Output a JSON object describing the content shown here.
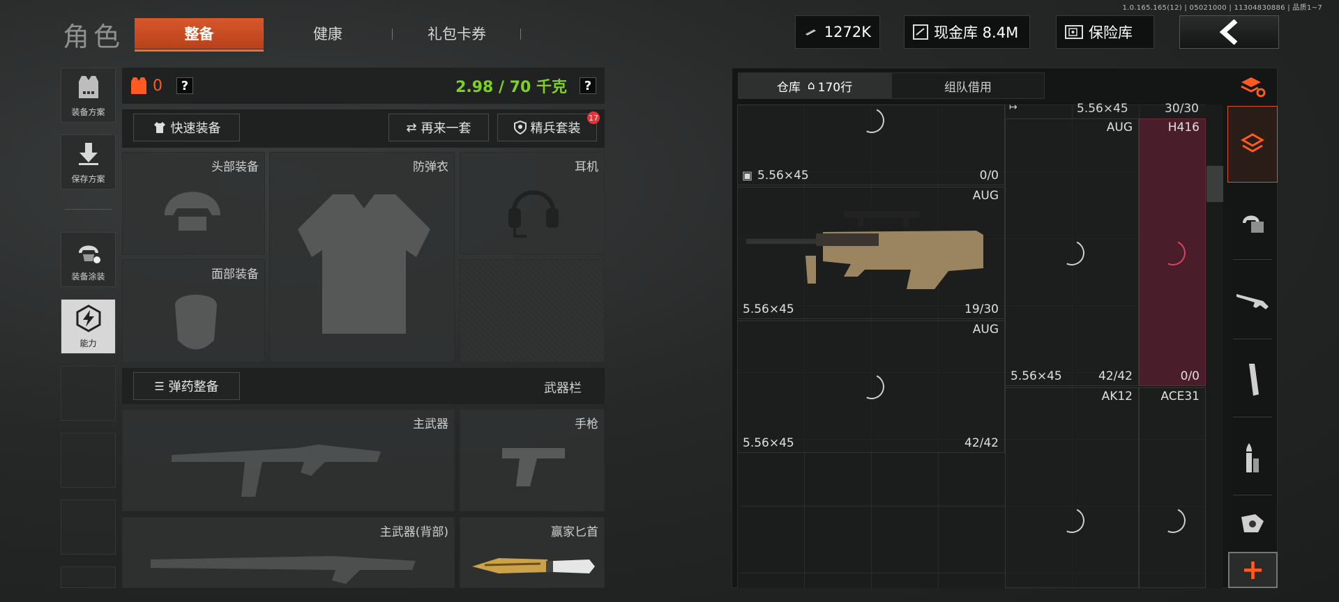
{
  "version": "1.0.165.165(12) | 05021000 | 11304830886 | 品质1~7",
  "nav": {
    "title": "角色",
    "tabs": [
      "整备",
      "健康",
      "礼包卡券"
    ],
    "currency": {
      "money": "1272K",
      "cash_vault": "现金库 8.4M",
      "safe": "保险库"
    }
  },
  "side": [
    "装备方案",
    "保存方案",
    "装备涂装",
    "能力"
  ],
  "equip": {
    "armor_count": "0",
    "weight": "2.98 / 70 千克",
    "help": "?",
    "quick_equip": "快速装备",
    "repeat": "再来一套",
    "elite": "精兵套装",
    "elite_badge": "17",
    "slots": {
      "head": "头部装备",
      "vest": "防弹衣",
      "headset": "耳机",
      "face": "面部装备",
      "primary": "主武器",
      "pistol": "手枪",
      "primary_back": "主武器(背部)",
      "knife": "赢家匕首"
    },
    "ammo_btn": "弹药整备",
    "weapon_bar": "武器栏"
  },
  "warehouse": {
    "tab_storage": "仓库",
    "rows": "170行",
    "tab_team": "组队借用",
    "items": [
      {
        "name": "",
        "cal": "5.56×45",
        "count_a": "0",
        "count_b": "0"
      },
      {
        "name": "AUG",
        "cal": "5.56×45",
        "count": "19/30"
      },
      {
        "name": "AUG",
        "cal": "5.56×45",
        "count": "42/42"
      },
      {
        "name": "",
        "cal": "5.56×45",
        "count": "30/30"
      },
      {
        "name": "AUG",
        "cal": "5.56×45",
        "count": "42/42"
      },
      {
        "name": "H416",
        "cal": "",
        "count_a": "0",
        "count_b": "0"
      },
      {
        "name": "AK12"
      },
      {
        "name": "ACE31"
      }
    ]
  },
  "colors": {
    "accent": "#d8572a",
    "green": "#7ed321",
    "red": "#e03a5c"
  }
}
